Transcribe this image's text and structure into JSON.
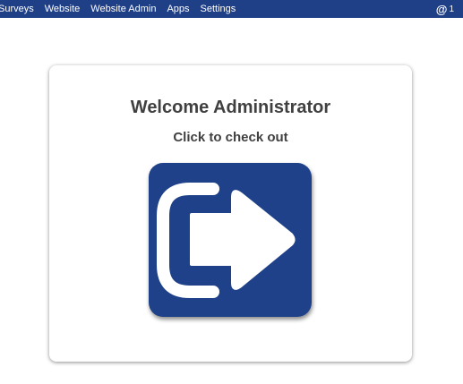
{
  "nav": {
    "items": [
      {
        "name": "nav-surveys",
        "label": "Surveys"
      },
      {
        "name": "nav-website",
        "label": "Website"
      },
      {
        "name": "nav-website-admin",
        "label": "Website Admin"
      },
      {
        "name": "nav-apps",
        "label": "Apps"
      },
      {
        "name": "nav-settings",
        "label": "Settings"
      }
    ],
    "mention_icon": "@",
    "mention_count": "1"
  },
  "card": {
    "welcome": "Welcome Administrator",
    "subtitle": "Click to check out"
  },
  "colors": {
    "navbar": "#1f3f87",
    "button": "#1f4189",
    "text": "#404040"
  },
  "icons": {
    "checkout": "sign-out-icon"
  }
}
